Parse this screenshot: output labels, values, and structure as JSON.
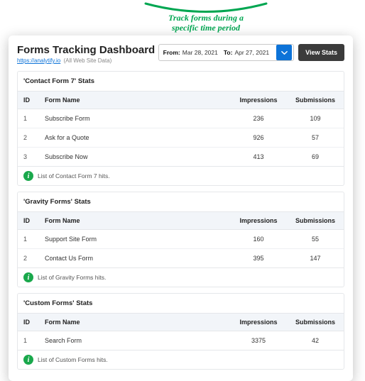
{
  "annotation": {
    "line1": "Track forms during a",
    "line2": "specific time period"
  },
  "header": {
    "title": "Forms Tracking Dashboard",
    "link_text": "https://analytify.io",
    "link_extra": "(All Web Site Data)",
    "date_from_label": "From:",
    "date_from_value": "Mar 28, 2021",
    "date_to_label": "To:",
    "date_to_value": "Apr 27, 2021",
    "view_button": "View Stats"
  },
  "columns": {
    "id": "ID",
    "form_name": "Form Name",
    "impressions": "Impressions",
    "submissions": "Submissions"
  },
  "sections": [
    {
      "title": "'Contact Form 7' Stats",
      "footer": "List of Contact Form 7 hits.",
      "rows": [
        {
          "id": "1",
          "name": "Subscribe Form",
          "imp": "236",
          "sub": "109"
        },
        {
          "id": "2",
          "name": "Ask for a Quote",
          "imp": "926",
          "sub": "57"
        },
        {
          "id": "3",
          "name": "Subscribe Now",
          "imp": "413",
          "sub": "69"
        }
      ]
    },
    {
      "title": "'Gravity Forms' Stats",
      "footer": "List of Gravity Forms hits.",
      "rows": [
        {
          "id": "1",
          "name": "Support Site Form",
          "imp": "160",
          "sub": "55"
        },
        {
          "id": "2",
          "name": "Contact Us Form",
          "imp": "395",
          "sub": "147"
        }
      ]
    },
    {
      "title": "'Custom Forms' Stats",
      "footer": "List of Custom Forms hits.",
      "rows": [
        {
          "id": "1",
          "name": "Search Form",
          "imp": "3375",
          "sub": "42"
        }
      ]
    }
  ]
}
